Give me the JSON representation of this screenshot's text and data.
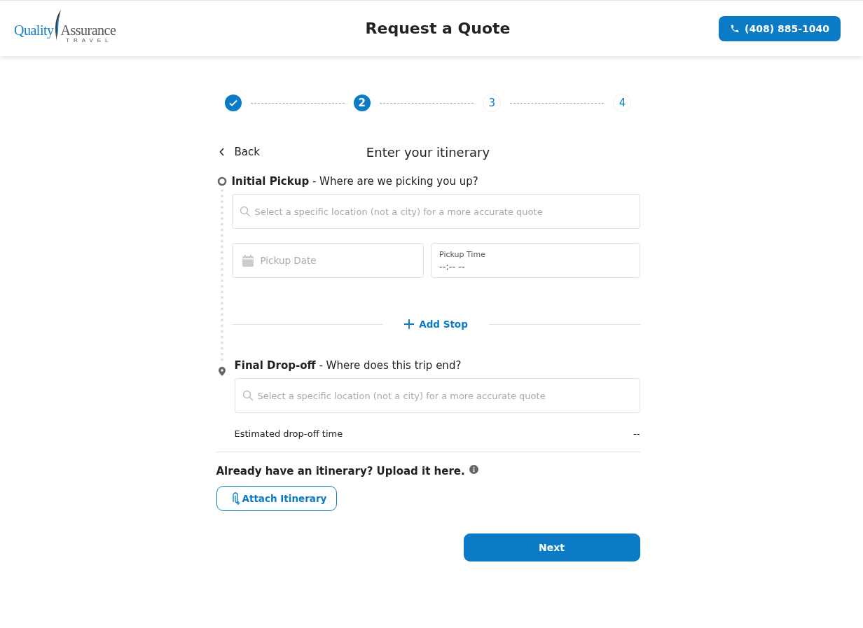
{
  "header": {
    "logo": {
      "word_1": "Quality",
      "word_2": "Assurance",
      "tagline": "TRAVEL"
    },
    "title": "Request a Quote",
    "phone_button": "(408) 885-1040"
  },
  "steps": [
    {
      "completed": true,
      "current": false
    },
    {
      "label": "2",
      "completed": false,
      "current": true
    },
    {
      "label": "3",
      "completed": false,
      "current": false
    },
    {
      "label": "4",
      "completed": false,
      "current": false
    }
  ],
  "back_link": "Back",
  "page_title": "Enter your itinerary",
  "pickup": {
    "heading": "**Initial Pickup** - Where are we picking you up?",
    "location_placeholder": "Select a specific location (not a city) for a more accurate quote",
    "date_placeholder": "Pickup Date",
    "time_label": "Pickup Time",
    "time_value": "--:-- --"
  },
  "add_stop": "Add Stop",
  "dropoff": {
    "heading": "**Final Drop-off** - Where does this trip end?",
    "location_placeholder": "Select a specific location (not a city) for a more accurate quote",
    "estimate_label": "Estimated drop-off time",
    "estimate_value": "--"
  },
  "upload": {
    "prompt": "Already have an itinerary? Upload it here.",
    "button": "Attach Itinerary"
  },
  "next_button": "Next"
}
